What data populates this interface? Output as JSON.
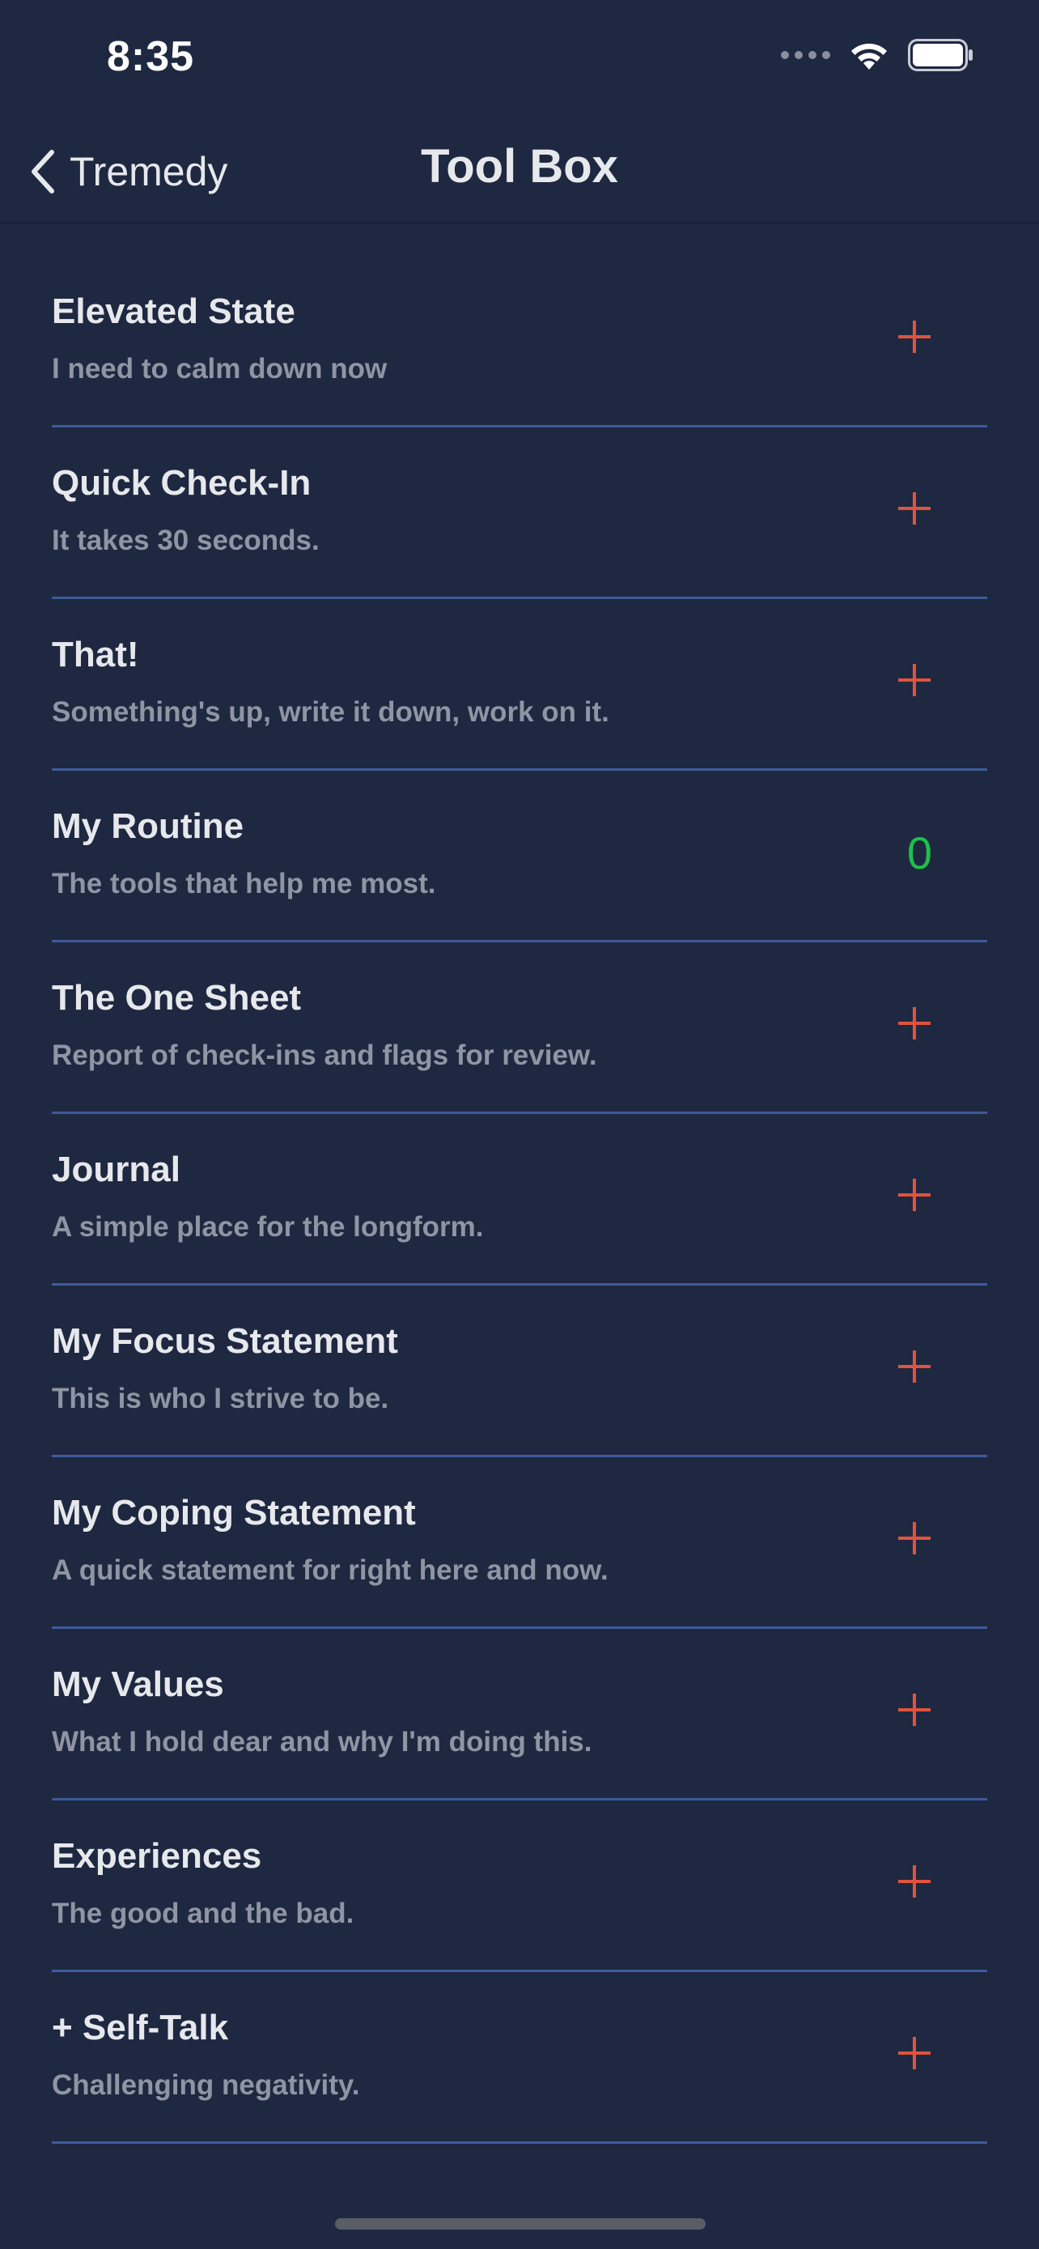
{
  "status_bar": {
    "time": "8:35"
  },
  "nav": {
    "back_label": "Tremedy",
    "title": "Tool Box"
  },
  "colors": {
    "background": "#1e2841",
    "divider": "#3e5a9a",
    "plus": "#e0533c",
    "count": "#1fbf4a"
  },
  "tools": [
    {
      "title": "Elevated State",
      "subtitle": "I need to calm down now",
      "action": "plus-icon"
    },
    {
      "title": "Quick Check-In",
      "subtitle": "It takes 30 seconds.",
      "action": "plus-icon"
    },
    {
      "title": "That!",
      "subtitle": "Something's up, write it down, work on it.",
      "action": "plus-icon"
    },
    {
      "title": "My Routine",
      "subtitle": "The tools that help me most.",
      "count": "0"
    },
    {
      "title": "The One Sheet",
      "subtitle": "Report of check-ins and flags for review.",
      "action": "plus-icon"
    },
    {
      "title": "Journal",
      "subtitle": "A simple place for the longform.",
      "action": "plus-icon"
    },
    {
      "title": "My Focus Statement",
      "subtitle": "This is who I strive to be.",
      "action": "plus-icon"
    },
    {
      "title": "My Coping Statement",
      "subtitle": "A quick statement for right here and now.",
      "action": "plus-icon"
    },
    {
      "title": "My Values",
      "subtitle": "What I hold dear and why I'm doing this.",
      "action": "plus-icon"
    },
    {
      "title": "Experiences",
      "subtitle": "The good and the bad.",
      "action": "plus-icon"
    },
    {
      "title": "+ Self-Talk",
      "subtitle": "Challenging negativity.",
      "action": "plus-icon"
    }
  ]
}
